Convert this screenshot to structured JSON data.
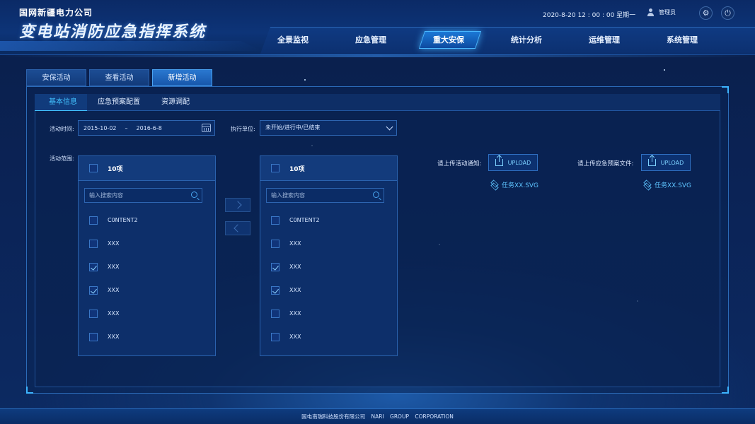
{
  "header": {
    "company": "国网新疆电力公司",
    "system_title": "变电站消防应急指挥系统",
    "datetime": "2020-8-20  12 : 00 : 00   星期一",
    "user_name": "管理员",
    "settings_icon": "gear-icon",
    "power_icon": "power-icon"
  },
  "nav": {
    "items": [
      "全景监视",
      "应急管理",
      "重大安保",
      "统计分析",
      "运维管理",
      "系统管理"
    ],
    "active": "重大安保"
  },
  "top_tabs": [
    "安保活动",
    "查看活动",
    "新增活动"
  ],
  "top_tabs_active": "新增活动",
  "sub_tabs": [
    "基本信息",
    "应急预案配置",
    "资源调配"
  ],
  "sub_tabs_active": "基本信息",
  "form": {
    "time_label": "活动时间:",
    "start_date": "2015-10-02",
    "date_sep": "–",
    "end_date": "2016-6-8",
    "unit_label": "执行单位:",
    "unit_value": "未开始/进行中/已结束",
    "scope_label": "活动范围:"
  },
  "transfer_left": {
    "count": "10项",
    "search_placeholder": "输入搜索内容",
    "items": [
      {
        "label": "C0NTENT2",
        "checked": false
      },
      {
        "label": "XXX",
        "checked": false
      },
      {
        "label": "XXX",
        "checked": true
      },
      {
        "label": "XXX",
        "checked": true
      },
      {
        "label": "XXX",
        "checked": false
      },
      {
        "label": "XXX",
        "checked": false
      }
    ]
  },
  "transfer_right": {
    "count": "10项",
    "search_placeholder": "输入搜索内容",
    "items": [
      {
        "label": "C0NTENT2",
        "checked": false
      },
      {
        "label": "XXX",
        "checked": false
      },
      {
        "label": "XXX",
        "checked": true
      },
      {
        "label": "XXX",
        "checked": true
      },
      {
        "label": "XXX",
        "checked": false
      },
      {
        "label": "XXX",
        "checked": false
      }
    ]
  },
  "upload": {
    "notice_label": "请上传活动通知:",
    "plan_label": "请上传应急预案文件:",
    "button_label": "UPLOAD",
    "notice_file": "任务XX.SVG",
    "plan_file": "任务XX.SVG"
  },
  "footer": {
    "text": "国电南瑞科技股份有限公司  NARI GROUP CORPORATION"
  }
}
